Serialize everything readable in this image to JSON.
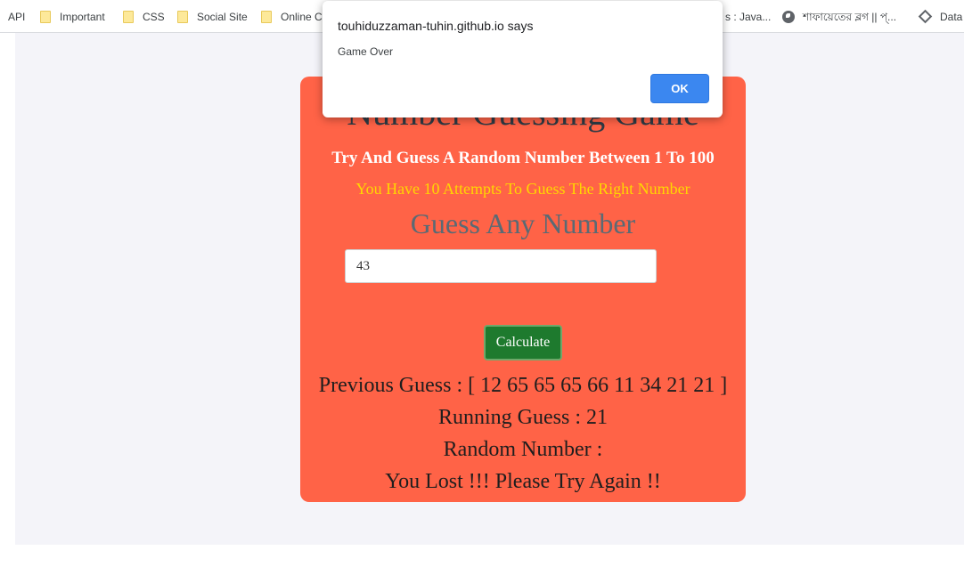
{
  "bookmarks": {
    "items": [
      {
        "label": "API",
        "icon": "none"
      },
      {
        "label": "Important",
        "icon": "folder-icon"
      },
      {
        "label": "CSS",
        "icon": "folder-icon"
      },
      {
        "label": "Social Site",
        "icon": "folder-icon"
      },
      {
        "label": "Online Co",
        "icon": "folder-icon"
      },
      {
        "label": "s : Java...",
        "icon": "none"
      },
      {
        "label": "শাফায়েতের ব্লগ || প্...",
        "icon": "globe-icon"
      },
      {
        "label": "Data",
        "icon": "diamond-icon"
      }
    ]
  },
  "game": {
    "title": "Number Guessing Game",
    "subtitle": "Try And Guess A Random Number Between 1 To 100",
    "attempts_text": "You Have 10 Attempts To Guess The Right Number",
    "guess_heading": "Guess Any Number",
    "guess_value": "43",
    "calculate_label": "Calculate",
    "previous_guess": "Previous Guess : [ 12 65 65 65 66 11 34 21 21 ]",
    "running_guess": "Running Guess : 21",
    "random_number": "Random Number :",
    "result_message": "You Lost !!! Please Try Again !!"
  },
  "dialog": {
    "title": "touhiduzzaman-tuhin.github.io says",
    "message": "Game Over",
    "ok_label": "OK"
  },
  "colors": {
    "card_background": "#ff6347",
    "attempts_text": "#ffd700",
    "calculate_button": "#1e7a2e",
    "dialog_ok_button": "#3b87f0",
    "page_background": "#f4f4f9"
  }
}
